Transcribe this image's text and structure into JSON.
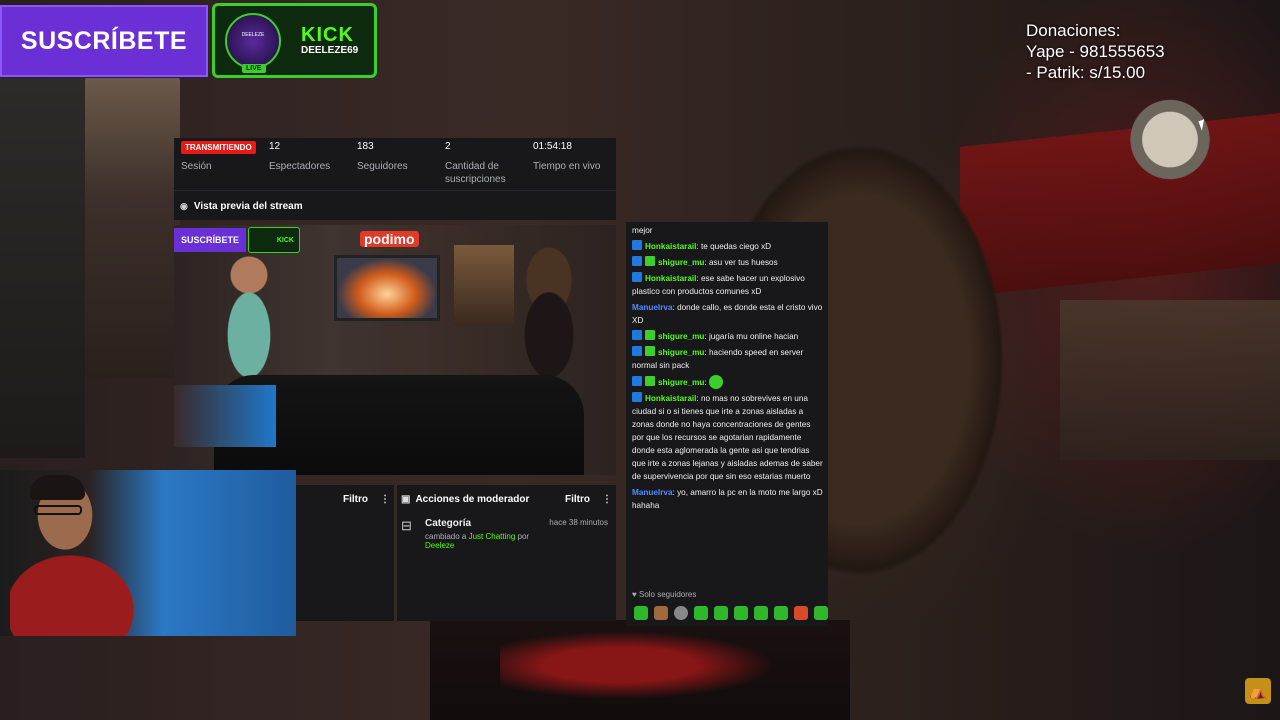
{
  "overlay": {
    "subscribe_label": "SUSCRÍBETE",
    "kick_logo": "KICK",
    "kick_username": "DEELEZE69",
    "live_badge": "LIVE",
    "kick_avatar_text": "DEELEZE",
    "donations_lines": [
      "Donaciones:",
      "Yape - 981555653",
      "- Patrik: s/15.00"
    ]
  },
  "dashboard": {
    "live_status": "TRANSMITIENDO",
    "session_label": "Sesión",
    "stats": [
      {
        "value": "12",
        "label": "Espectadores"
      },
      {
        "value": "183",
        "label": "Seguidores"
      },
      {
        "value": "2",
        "label": "Cantidad de suscripciones"
      },
      {
        "value": "01:54:18",
        "label": "Tiempo en vivo"
      }
    ],
    "preview_title": "Vista previa del stream",
    "preview_inner": {
      "subscribe": "SUSCRÍBETE",
      "kick": "KICK",
      "podimo": "podimo"
    }
  },
  "filter_panel": {
    "title": "Filtro"
  },
  "mod_panel": {
    "title": "Acciones de moderador",
    "filter_label": "Filtro",
    "event": {
      "title": "Categoría",
      "sub_prefix": "cambiado a",
      "category": "Just Chatting",
      "sub_mid": "por",
      "by": "Deeleze",
      "time": "hace 38 minutos"
    }
  },
  "chat": {
    "messages": [
      {
        "user": "",
        "text": "mejor",
        "badges": [],
        "color": "blue"
      },
      {
        "user": "Honkaistarail",
        "text": "te quedas ciego xD",
        "badges": [
          "kick"
        ],
        "color": "green"
      },
      {
        "user": "shigure_mu",
        "text": "asu ver tus huesos",
        "badges": [
          "kick",
          "sub"
        ],
        "color": "green"
      },
      {
        "user": "Honkaistarail",
        "text": "ese sabe hacer un explosivo plastico con productos comunes xD",
        "badges": [
          "kick"
        ],
        "color": "green"
      },
      {
        "user": "Manuelrva",
        "text": "donde callo, es donde esta el cristo vivo XD",
        "badges": [],
        "color": "blue"
      },
      {
        "user": "shigure_mu",
        "text": "jugaría mu online hacian",
        "badges": [
          "kick",
          "sub"
        ],
        "color": "green"
      },
      {
        "user": "shigure_mu",
        "text": "haciendo speed en server normal sin pack",
        "badges": [
          "kick",
          "sub"
        ],
        "color": "green"
      },
      {
        "user": "shigure_mu",
        "text": "",
        "badges": [
          "kick",
          "sub"
        ],
        "color": "green",
        "emote": true
      },
      {
        "user": "Honkaistarail",
        "text": "no mas no sobrevives en una ciudad si o si tienes que irte a zonas aisladas a zonas donde no haya concentraciones de gentes por que los recursos se agotarian rapidamente donde esta aglomerada la gente asi que tendrias que irte a zonas lejanas y aisladas ademas de saber de supervivencia por que sin eso estarias muerto",
        "badges": [
          "kick"
        ],
        "color": "green"
      },
      {
        "user": "Manuelrva",
        "text": "yo, amarro la pc en la moto me largo xD hahaha",
        "badges": [],
        "color": "blue"
      }
    ],
    "followers_only": "Solo seguidores"
  },
  "colors": {
    "kick_green": "#53fc18",
    "purple": "#6b2fd6",
    "live_red": "#e91916",
    "panel": "#18181b"
  }
}
